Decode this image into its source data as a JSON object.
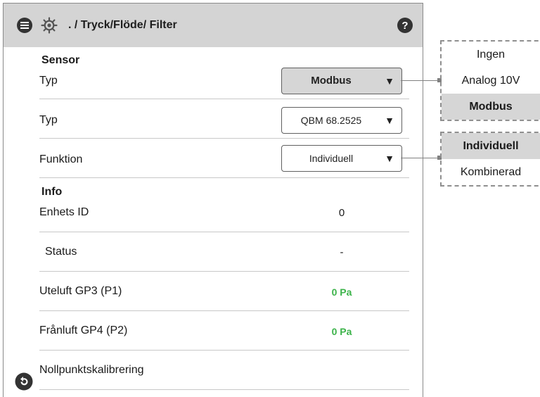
{
  "header": {
    "title": ". / Tryck/Flöde/ Filter",
    "icons": [
      "menu-icon",
      "gear-icon",
      "help-icon"
    ]
  },
  "sensor": {
    "heading": "Sensor",
    "rows": [
      {
        "label": "Typ",
        "value": "Modbus"
      },
      {
        "label": "Typ",
        "value": "QBM 68.2525"
      },
      {
        "label": "Funktion",
        "value": "Individuell"
      }
    ]
  },
  "info": {
    "heading": "Info",
    "rows": [
      {
        "label": "Enhets ID",
        "value": "0"
      },
      {
        "label": "Status",
        "value": "-"
      },
      {
        "label": "Uteluft GP3 (P1)",
        "value": "0 Pa"
      },
      {
        "label": "Frånluft GP4 (P2)",
        "value": "0 Pa"
      },
      {
        "label": "Nollpunktskalibrering",
        "value": ""
      }
    ]
  },
  "dropdown_arrow": "▼",
  "options_type": [
    "Ingen",
    "Analog 10V",
    "Modbus"
  ],
  "options_function": [
    "Individuell",
    "Kombinerad"
  ],
  "colors": {
    "header_bg": "#d4d4d4",
    "active_dropdown_bg": "#d6d6d6",
    "value_green": "#3cb34a",
    "icon_dark": "#333333"
  }
}
